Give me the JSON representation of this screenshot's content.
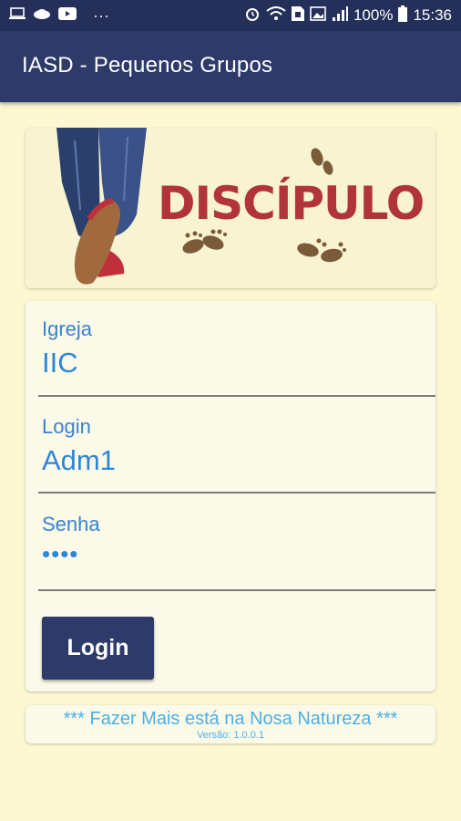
{
  "status_bar": {
    "left_icons": [
      "laptop-icon",
      "cloud-icon",
      "youtube-icon",
      "more-icon"
    ],
    "more": "···",
    "battery": "100%",
    "time": "15:36"
  },
  "app_bar": {
    "title": "IASD - Pequenos Grupos"
  },
  "banner": {
    "word": "DISCÍPULO"
  },
  "form": {
    "igreja_label": "Igreja",
    "igreja_value": "IIC",
    "login_label": "Login",
    "login_value": "Adm1",
    "senha_label": "Senha",
    "senha_value": "••••",
    "login_button": "Login"
  },
  "footer": {
    "motto": "*** Fazer Mais está na Nosa Natureza ***",
    "version": "Versão: 1.0.0.1"
  },
  "colors": {
    "status_bar": "#25305a",
    "app_bar": "#2e3a6a",
    "background": "#fdf8d2",
    "label": "#3a82d0",
    "value": "#2e86d8",
    "accent_text": "#4ab0e6",
    "banner_word": "#b0343a"
  }
}
